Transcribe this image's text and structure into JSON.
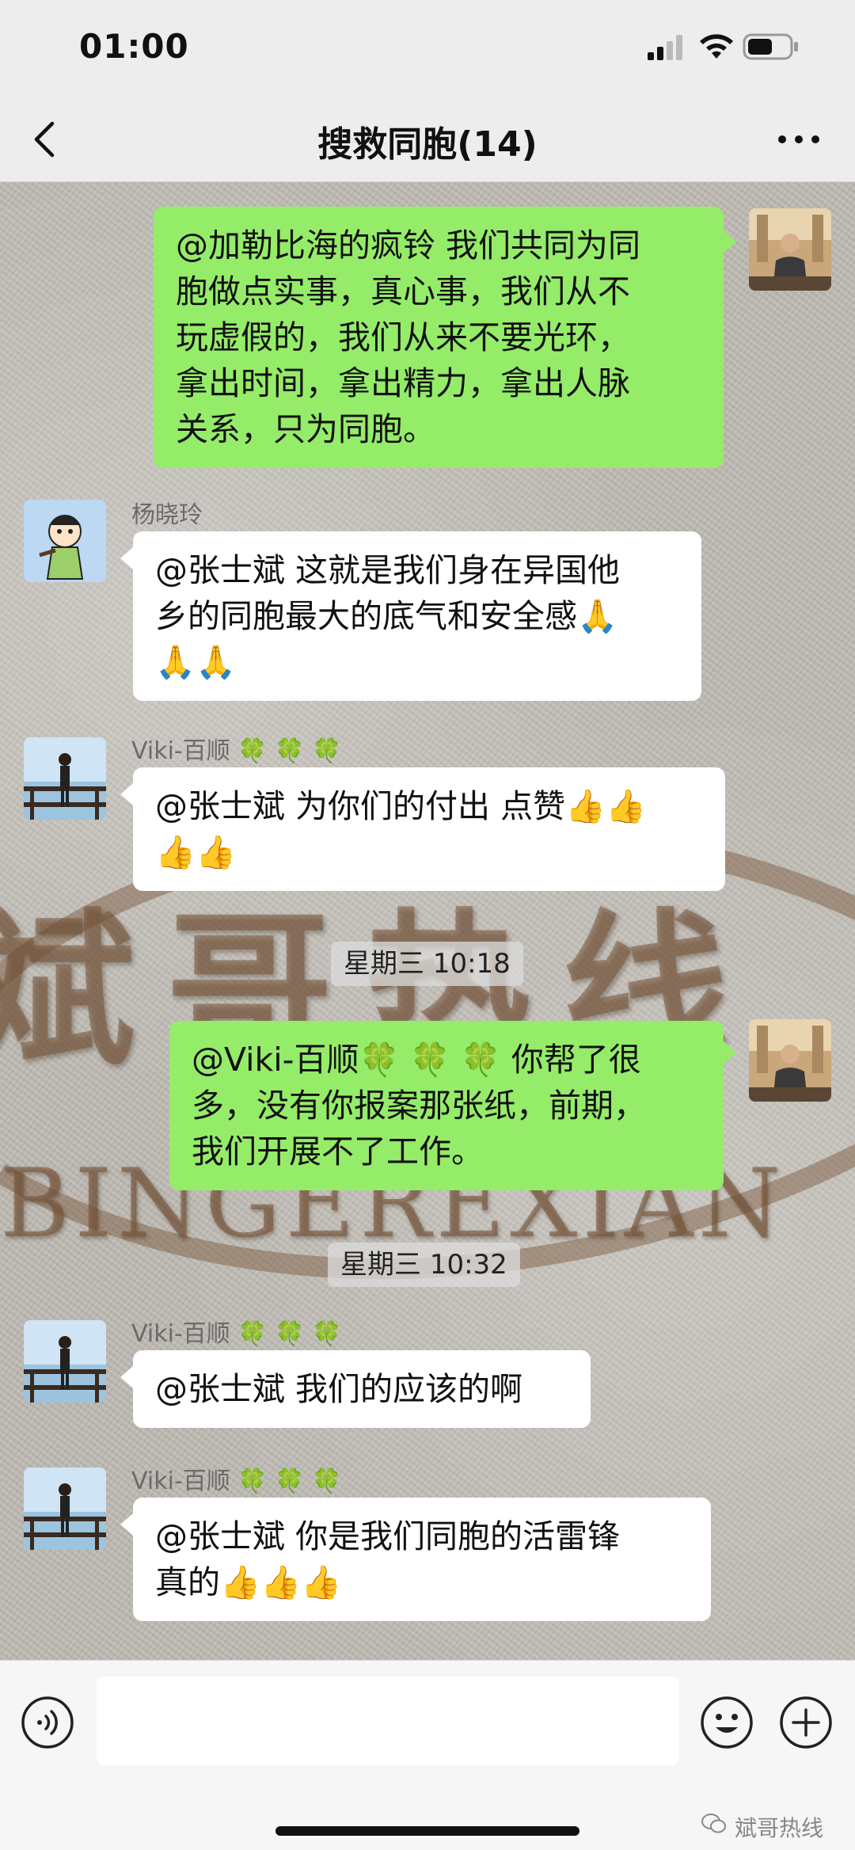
{
  "status_bar": {
    "time": "01:00"
  },
  "nav": {
    "title": "搜救同胞(14)"
  },
  "chat": {
    "messages": [
      {
        "side": "right",
        "lines": [
          "@加勒比海的疯铃 我们共同为同",
          "胞做点实事，真心事，我们从不",
          "玩虚假的，我们从来不要光环，",
          "拿出时间，拿出精力，拿出人脉",
          "关系，只为同胞。"
        ]
      },
      {
        "side": "left",
        "sender": "杨晓玲",
        "lines": [
          "@张士斌 这就是我们身在异国他",
          "乡的同胞最大的底气和安全感🙏",
          "🙏🙏"
        ]
      },
      {
        "side": "left",
        "sender": "Viki-百顺",
        "lines": [
          "@张士斌 为你们的付出 点赞👍👍",
          "👍👍"
        ]
      },
      {
        "timestamp": "星期三 10:18"
      },
      {
        "side": "right",
        "lines": [
          "@Viki-百顺🍀 🍀 🍀 你帮了很",
          "多，没有你报案那张纸，前期，",
          "我们开展不了工作。"
        ]
      },
      {
        "timestamp": "星期三 10:32"
      },
      {
        "side": "left",
        "sender": "Viki-百顺",
        "lines": [
          "@张士斌 我们的应该的啊"
        ]
      },
      {
        "side": "left",
        "sender": "Viki-百顺",
        "lines": [
          "@张士斌 你是我们同胞的活雷锋",
          "真的👍👍👍"
        ]
      }
    ],
    "clover_suffix": "🍀 🍀 🍀",
    "background_watermark": {
      "chinese": "斌哥热线",
      "english": "BINGEREXIAN"
    }
  },
  "input_bar": {
    "watermark_label": "斌哥热线"
  },
  "colors": {
    "green_bubble": "#95ec69",
    "white_bubble": "#ffffff",
    "header_bg": "#ededed"
  },
  "icons": {
    "back": "chevron-left-icon",
    "more": "more-dots-icon",
    "voice": "voice-icon",
    "emoji": "emoji-icon",
    "plus": "plus-icon"
  }
}
